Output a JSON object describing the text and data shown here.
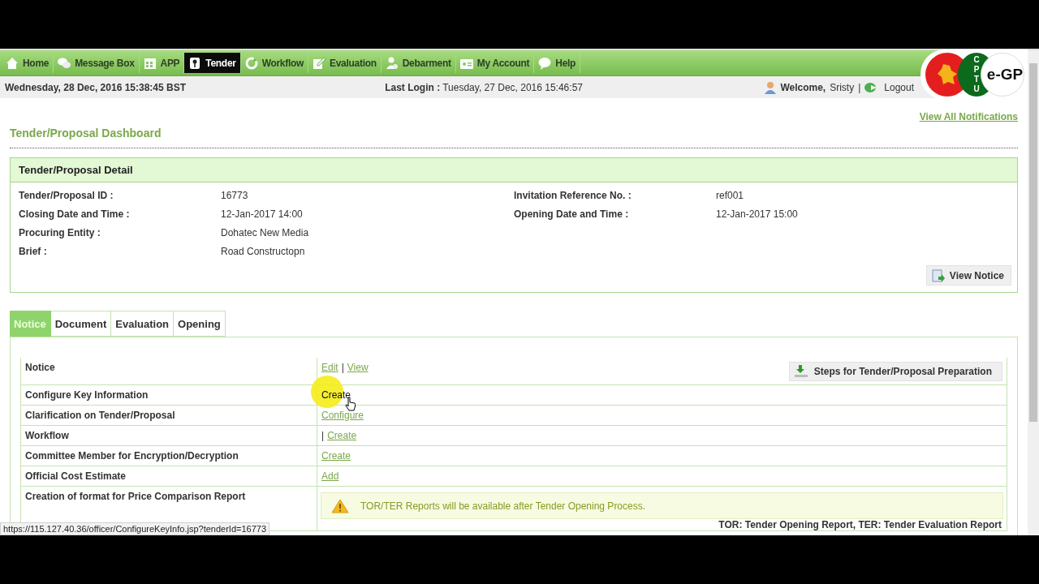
{
  "nav": [
    {
      "label": "Home",
      "selected": false
    },
    {
      "label": "Message Box",
      "selected": false
    },
    {
      "label": "APP",
      "selected": false
    },
    {
      "label": "Tender",
      "selected": true
    },
    {
      "label": "Workflow",
      "selected": false
    },
    {
      "label": "Evaluation",
      "selected": false
    },
    {
      "label": "Debarment",
      "selected": false
    },
    {
      "label": "My Account",
      "selected": false
    },
    {
      "label": "Help",
      "selected": false
    }
  ],
  "info_bar": {
    "datetime": "Wednesday, 28 Dec, 2016 15:38:45 BST",
    "last_login_label": "Last Login :",
    "last_login": "Tuesday, 27 Dec, 2016 15:46:57",
    "welcome_label": "Welcome,",
    "user": "Sristy",
    "separator": "|",
    "logout": "Logout"
  },
  "logo": {
    "letters": [
      "C",
      "P",
      "T",
      "U"
    ],
    "text": "e-GP"
  },
  "notifications_link": "View All Notifications",
  "page_title": "Tender/Proposal Dashboard",
  "detail": {
    "title": "Tender/Proposal Detail",
    "left_fields": [
      {
        "label": "Tender/Proposal ID :",
        "value": "16773"
      },
      {
        "label": "Closing Date and Time :",
        "value": "12-Jan-2017 14:00"
      },
      {
        "label": "Procuring Entity :",
        "value": "Dohatec New Media"
      },
      {
        "label": "Brief :",
        "value": "Road Constructopn"
      }
    ],
    "right_fields": [
      {
        "label": "Invitation Reference No. :",
        "value": "ref001"
      },
      {
        "label": "Opening Date and Time :",
        "value": "12-Jan-2017 15:00"
      }
    ],
    "button": "View Notice"
  },
  "tabs": [
    {
      "label": "Notice",
      "selected": true
    },
    {
      "label": "Document",
      "selected": false
    },
    {
      "label": "Evaluation",
      "selected": false
    },
    {
      "label": "Opening",
      "selected": false
    }
  ],
  "rows": [
    {
      "label": "Notice",
      "actions": [
        {
          "kind": "link",
          "text": "Edit",
          "hovered": false
        },
        {
          "kind": "separator",
          "text": "|"
        },
        {
          "kind": "link",
          "text": "View",
          "hovered": false
        }
      ],
      "button": "Steps for Tender/Proposal Preparation"
    },
    {
      "label": "Configure Key Information",
      "actions": [
        {
          "kind": "link",
          "text": "Create",
          "hovered": true
        }
      ]
    },
    {
      "label": "Clarification on Tender/Proposal",
      "actions": [
        {
          "kind": "link",
          "text": "Configure",
          "hovered": false
        }
      ]
    },
    {
      "label": "Workflow",
      "actions": [
        {
          "kind": "separator",
          "text": "|"
        },
        {
          "kind": "link",
          "text": "Create",
          "hovered": false
        }
      ]
    },
    {
      "label": "Committee Member for Encryption/Decryption",
      "actions": [
        {
          "kind": "link",
          "text": "Create",
          "hovered": false
        }
      ]
    },
    {
      "label": "Official Cost Estimate",
      "actions": [
        {
          "kind": "link",
          "text": "Add",
          "hovered": false
        }
      ]
    },
    {
      "label": "Creation of format for Price Comparison Report",
      "warning": "TOR/TER Reports will be available after Tender Opening Process.",
      "footnote": "TOR: Tender Opening Report, TER: Tender Evaluation Report"
    }
  ],
  "status_url": "https://115.127.40.36/officer/ConfigureKeyInfo.jsp?tenderId=16773"
}
